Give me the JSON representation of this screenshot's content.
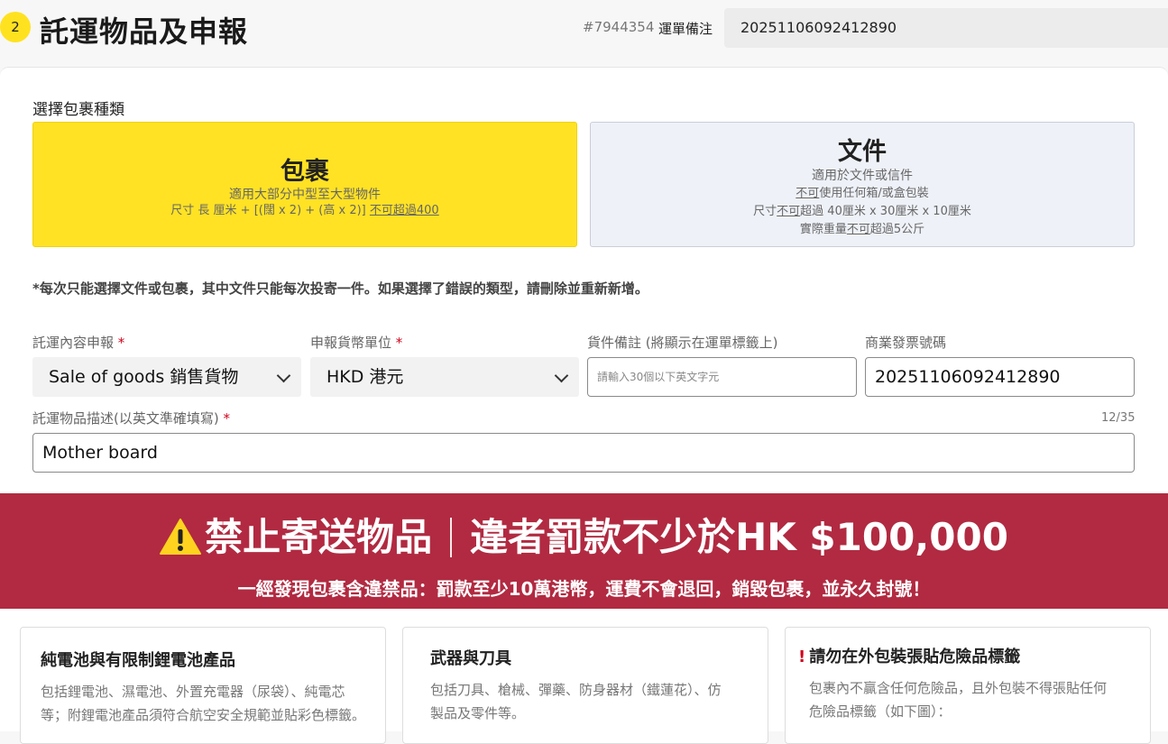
{
  "header": {
    "step_number": "2",
    "title": "託運物品及申報",
    "order_id": "#7944354",
    "order_note_label": "運單備注",
    "order_note_value": "20251106092412890"
  },
  "package_type": {
    "label": "選擇包裹種類",
    "parcel": {
      "title": "包裹",
      "line1": "適用大部分中型至大型物件",
      "line2_prefix": "尺寸 長 厘米 + [(闊 x 2) + (高 x 2)] ",
      "line2_underlined": "不可超過400"
    },
    "document": {
      "title": "文件",
      "line1": "適用於文件或信件",
      "line2_underlined": "不可",
      "line2_suffix": "使用任何箱/或盒包裝",
      "line3_prefix": "尺寸",
      "line3_underlined": "不可",
      "line3_suffix": "超過 40厘米 x 30厘米 x 10厘米",
      "line4_prefix": "實際重量",
      "line4_underlined": "不可",
      "line4_suffix": "超過5公斤"
    },
    "notice": "*每次只能選擇文件或包裹，其中文件只能每次投寄一件。如果選擇了錯誤的類型，請刪除並重新新增。"
  },
  "form": {
    "content_label": "託運內容申報",
    "content_value": "Sale of goods 銷售貨物",
    "currency_label": "申報貨幣單位",
    "currency_value": "HKD 港元",
    "note_label": "貨件備註 (將顯示在運單標籤上)",
    "note_placeholder": "請輸入30個以下英文字元",
    "invoice_label": "商業發票號碼",
    "invoice_value": "20251106092412890",
    "desc_label": "託運物品描述(以英文準確填寫)",
    "desc_count": "12/35",
    "desc_value": "Mother board",
    "required_mark": "*"
  },
  "banner": {
    "headline_left": "禁止寄送物品",
    "headline_right": "違者罰款不少於HK $100,000",
    "subline_prefix": "一經發現包裹含違禁品：",
    "subline_bold": "罰款至少10萬港幣",
    "subline_suffix": "，運費不會退回，銷毀包裹，並永久封號！"
  },
  "info_cards": [
    {
      "title": "純電池與有限制鋰電池產品",
      "text_line1": "包括鋰電池、濕電池、外置充電器（尿袋）、純電芯",
      "text_line2": "等；附鋰電池產品須符合航空安全規範並貼彩色標籤。"
    },
    {
      "title": "武器與刀具",
      "text_line1": "包括刀具、槍械、彈藥、防身器材（鐵蓮花）、仿",
      "text_line2": "製品及零件等。"
    },
    {
      "title": "請勿在外包裝張貼危險品標籤",
      "text_line1": "包裹內不贏含任何危險品，且外包裝不得張貼任何",
      "text_line2": "危險品標籤（如下圖）："
    }
  ],
  "colors": {
    "accent_yellow": "#ffe224",
    "banner_red": "#b12a41",
    "required_red": "#d0021b"
  }
}
